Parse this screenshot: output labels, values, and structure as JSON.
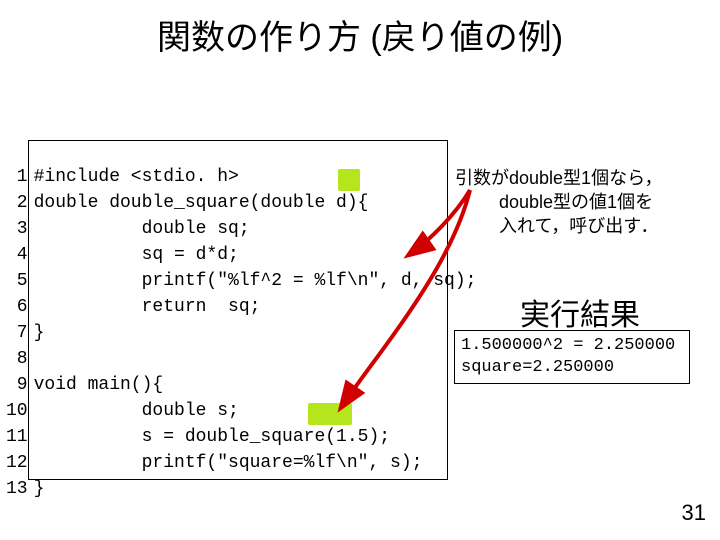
{
  "title": "関数の作り方 (戻り値の例)",
  "code": {
    "lines": [
      {
        "n": "1",
        "t": "#include <stdio. h>"
      },
      {
        "n": "2",
        "t": "double double_square(double d){"
      },
      {
        "n": "3",
        "t": "          double sq;"
      },
      {
        "n": "4",
        "t": "          sq = d*d;"
      },
      {
        "n": "5",
        "t": "          printf(\"%lf^2 = %lf\\n\", d, sq);"
      },
      {
        "n": "6",
        "t": "          return  sq;"
      },
      {
        "n": "7",
        "t": "}"
      },
      {
        "n": "8",
        "t": ""
      },
      {
        "n": "9",
        "t": "void main(){"
      },
      {
        "n": "10",
        "t": "          double s;"
      },
      {
        "n": "11",
        "t": "          s = double_square(1.5);"
      },
      {
        "n": "12",
        "t": "          printf(\"square=%lf\\n\", s);"
      },
      {
        "n": "13",
        "t": "}"
      }
    ]
  },
  "note1": {
    "line1": "引数がdouble型1個なら，",
    "line2": "double型の値1個を",
    "line3": "入れて，呼び出す．"
  },
  "result_title": "実行結果",
  "result": {
    "line1": "1.500000^2 = 2.250000",
    "line2": "square=2.250000"
  },
  "page_number": "31"
}
